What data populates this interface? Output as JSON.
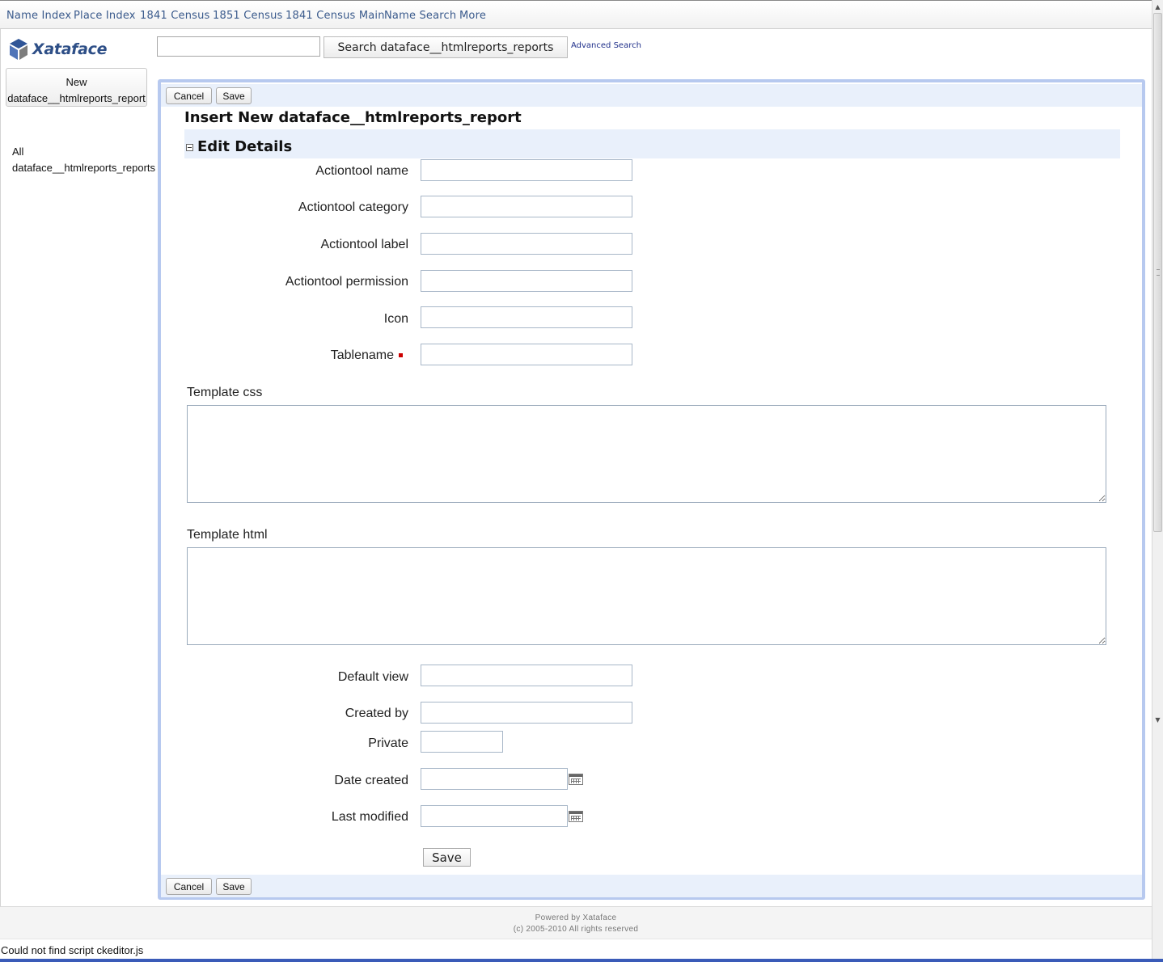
{
  "nav": {
    "items": [
      "Name Index",
      "Place Index",
      "1841 Census",
      "1851 Census",
      "1841 Census Main",
      "Name Search",
      "More"
    ]
  },
  "logo": {
    "text": "Xataface",
    "icon": "xataface-logo-icon"
  },
  "search": {
    "input_value": "",
    "button_label": "Search dataface__htmlreports_reports",
    "advanced_label": "Advanced Search"
  },
  "sidebar": {
    "new_button_line1": "New",
    "new_button_line2": "dataface__htmlreports_report",
    "all_line1": "All",
    "all_line2": "dataface__htmlreports_reports"
  },
  "form": {
    "cancel_label": "Cancel",
    "save_label": "Save",
    "title": "Insert New dataface__htmlreports_report",
    "section_title": "Edit Details",
    "fields": {
      "actiontool_name": "Actiontool name",
      "actiontool_category": "Actiontool category",
      "actiontool_label": "Actiontool label",
      "actiontool_permission": "Actiontool permission",
      "icon": "Icon",
      "tablename": "Tablename",
      "template_css": "Template css",
      "template_html": "Template html",
      "default_view": "Default view",
      "created_by": "Created by",
      "private": "Private",
      "date_created": "Date created",
      "last_modified": "Last modified"
    },
    "submit_label": "Save"
  },
  "footer": {
    "powered": "Powered by Xataface",
    "copyright": "(c) 2005-2010 All rights reserved"
  },
  "status": {
    "text": "Could not find script ckeditor.js"
  },
  "colors": {
    "accent": "#3a5a8c",
    "panel_border": "#b7c9ef",
    "strip": "#e9f0fb",
    "required": "#cc0000"
  }
}
